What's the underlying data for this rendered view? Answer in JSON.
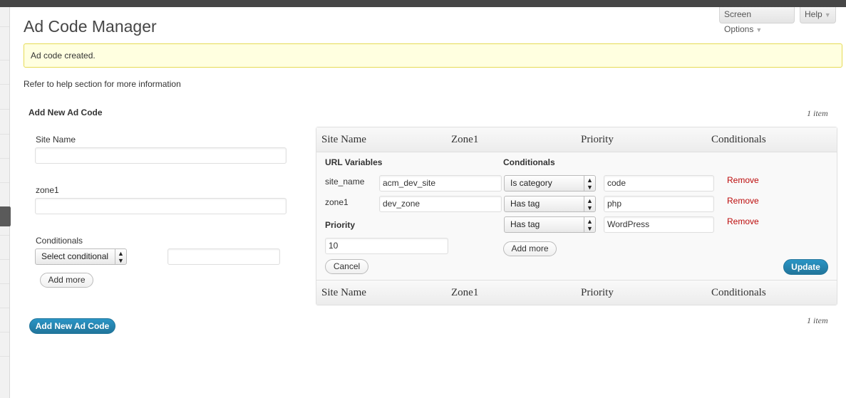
{
  "header": {
    "screen_options": "Screen Options",
    "help": "Help",
    "caret": "▼"
  },
  "page": {
    "title": "Ad Code Manager",
    "notice": "Ad code created.",
    "help_text": "Refer to help section for more information"
  },
  "add_form": {
    "heading": "Add New Ad Code",
    "site_name_label": "Site Name",
    "site_name_value": "",
    "zone1_label": "zone1",
    "zone1_value": "",
    "conditionals_label": "Conditionals",
    "conditional_select": "Select conditional",
    "conditional_value": "",
    "add_more": "Add more",
    "submit": "Add New Ad Code"
  },
  "table": {
    "count_top": "1 item",
    "count_bottom": "1 item",
    "columns": [
      "Site Name",
      "Zone1",
      "Priority",
      "Conditionals"
    ]
  },
  "edit_row": {
    "url_variables_heading": "URL Variables",
    "conditionals_heading": "Conditionals",
    "variables": [
      {
        "label": "site_name",
        "value": "acm_dev_site"
      },
      {
        "label": "zone1",
        "value": "dev_zone"
      }
    ],
    "priority_label": "Priority",
    "priority_value": "10",
    "conditionals": [
      {
        "function": "Is category",
        "value": "code",
        "remove": "Remove"
      },
      {
        "function": "Has tag",
        "value": "php",
        "remove": "Remove"
      },
      {
        "function": "Has tag",
        "value": "WordPress",
        "remove": "Remove"
      }
    ],
    "add_more": "Add more",
    "cancel": "Cancel",
    "update": "Update"
  },
  "colors": {
    "primary": "#21759b",
    "notice_bg": "#ffffe0",
    "remove_link": "#bc0b0b"
  }
}
